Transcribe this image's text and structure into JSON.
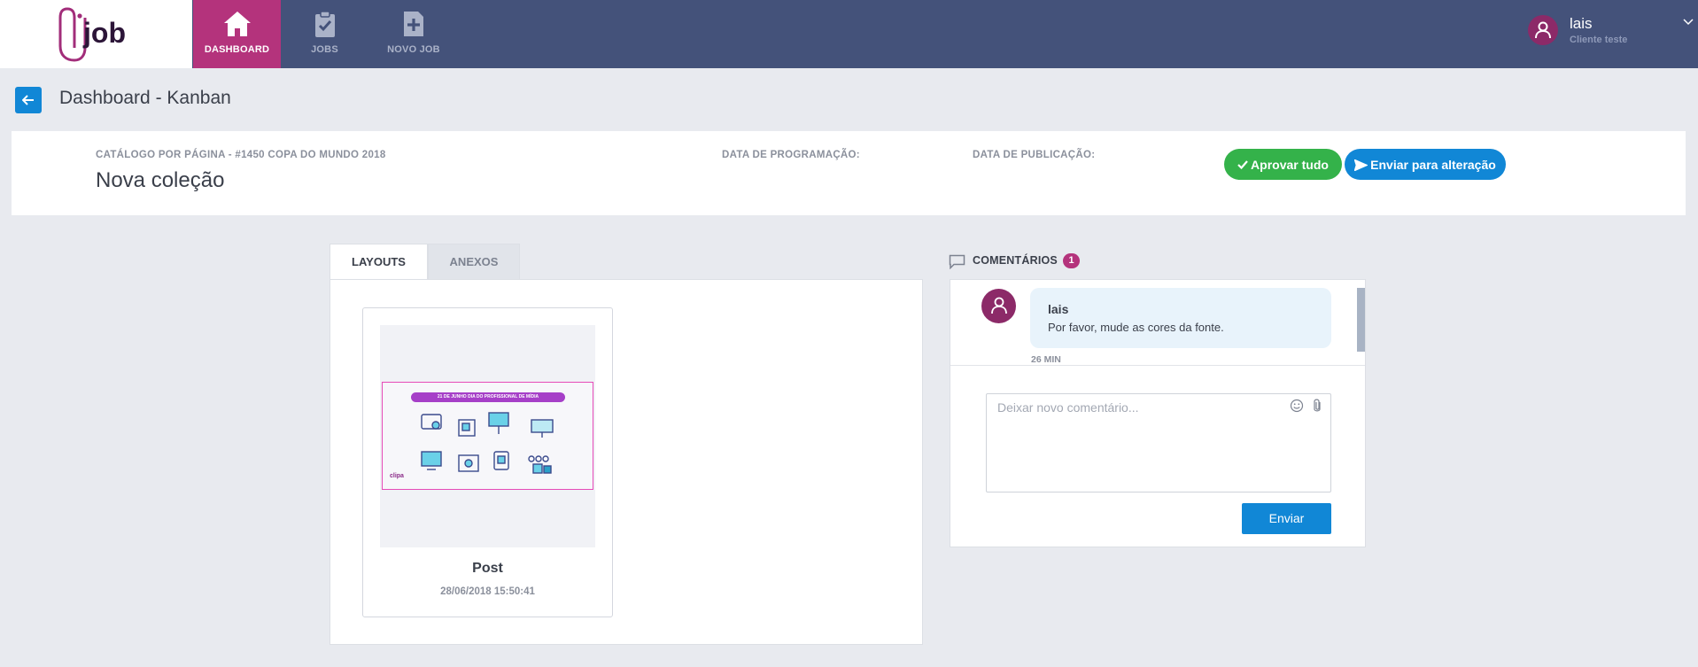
{
  "nav": {
    "logo_text": "job",
    "items": [
      {
        "label": "DASHBOARD",
        "icon": "home-icon",
        "active": true
      },
      {
        "label": "JOBS",
        "icon": "clipboard-check-icon",
        "active": false
      },
      {
        "label": "NOVO JOB",
        "icon": "file-plus-icon",
        "active": false
      }
    ],
    "user": {
      "name": "lais",
      "role": "Cliente teste"
    }
  },
  "header": {
    "title": "Dashboard - Kanban"
  },
  "info": {
    "catalog_label": "CATÁLOGO POR PÁGINA - #1450 COPA DO MUNDO 2018",
    "collection_title": "Nova coleção",
    "programming_label": "DATA DE PROGRAMAÇÃO:",
    "publication_label": "DATA DE PUBLICAÇÃO:",
    "approve_label": "Aprovar tudo",
    "send_change_label": "Enviar para alteração"
  },
  "tabs": [
    {
      "label": "LAYOUTS",
      "active": true
    },
    {
      "label": "ANEXOS",
      "active": false
    }
  ],
  "layout_card": {
    "title": "Post",
    "date": "28/06/2018 15:50:41",
    "thumb_banner": "21 DE JUNHO DIA DO PROFISSIONAL DE MÍDIA",
    "thumb_brand": "clipa"
  },
  "comments": {
    "title": "COMENTÁRIOS",
    "count": "1",
    "items": [
      {
        "author": "lais",
        "text": "Por favor, mude as cores da fonte.",
        "time": "26 MIN"
      }
    ],
    "input_placeholder": "Deixar novo comentário...",
    "send_label": "Enviar"
  },
  "colors": {
    "nav_bg": "#44527a",
    "nav_active": "#b4337c",
    "primary": "#1187d6",
    "success": "#34b24a",
    "avatar": "#8c2a68"
  }
}
